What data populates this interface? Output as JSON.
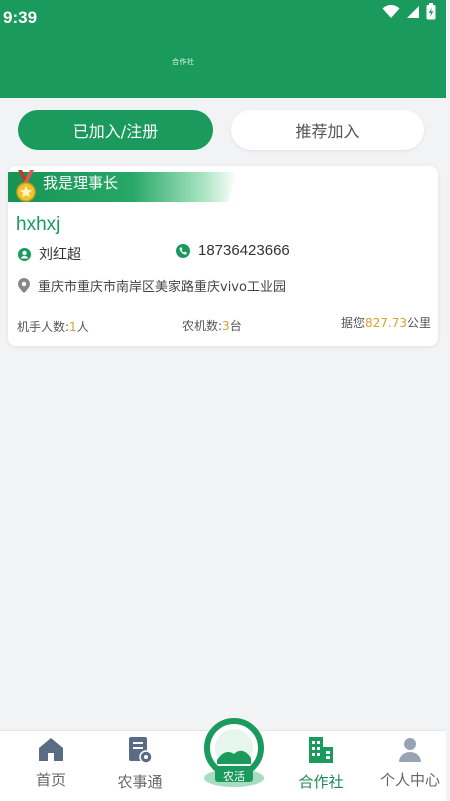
{
  "status_bar": {
    "time": "9:39"
  },
  "header": {
    "title": "合作社"
  },
  "tabs": [
    {
      "label": "已加入/注册",
      "active": true
    },
    {
      "label": "推荐加入",
      "active": false
    }
  ],
  "card": {
    "banner_label": "我是理事长",
    "name": "hxhxj",
    "contact_person": "刘红超",
    "phone": "18736423666",
    "address": "重庆市重庆市南岸区美家路重庆vivo工业园",
    "stats": {
      "operators_label": "机手人数:",
      "operators_value": "1",
      "operators_unit": "人",
      "machines_label": "农机数:",
      "machines_value": "3",
      "machines_unit": "台",
      "distance_prefix": "据您",
      "distance_value": "827.73",
      "distance_unit": "公里"
    }
  },
  "bottom_nav": {
    "items": [
      {
        "label": "首页",
        "icon": "home-icon",
        "active": false
      },
      {
        "label": "农事通",
        "icon": "farm-service-icon",
        "active": false
      },
      {
        "label": "农活",
        "icon": "farm-work-icon",
        "active": false
      },
      {
        "label": "合作社",
        "icon": "cooperative-icon",
        "active": true
      },
      {
        "label": "个人中心",
        "icon": "person-icon",
        "active": false
      }
    ]
  },
  "colors": {
    "brand": "#1a9a5c",
    "accent_number": "#d4a12a"
  }
}
